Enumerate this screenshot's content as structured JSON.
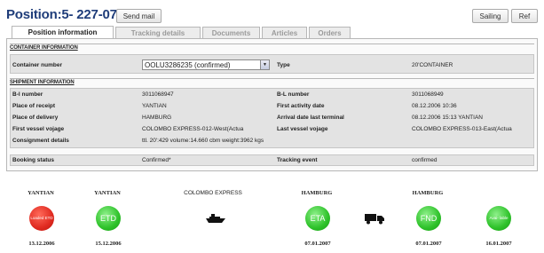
{
  "header": {
    "title": "Position:5- 227-07",
    "send_mail": "Send mail",
    "sailing": "Sailing",
    "ref": "Ref"
  },
  "tabs": [
    {
      "label": "Position information",
      "active": true
    },
    {
      "label": "Tracking details",
      "active": false
    },
    {
      "label": "Documents",
      "active": false
    },
    {
      "label": "Articles",
      "active": false
    },
    {
      "label": "Orders",
      "active": false
    }
  ],
  "container": {
    "heading": "CONTAINER INFORMATION",
    "number_label": "Container number",
    "number_value": "OOLU3286235 (confirmed)",
    "type_label": "Type",
    "type_value": "20'CONTAINER"
  },
  "shipment": {
    "heading": "SHIPMENT INFORMATION",
    "bl_number_label": "B-l number",
    "bl_number_value": "3011068947",
    "bl_number2_label": "B-L number",
    "bl_number2_value": "3011068949",
    "place_receipt_label": "Place of receipt",
    "place_receipt_value": "YANTIAN",
    "first_activity_label": "First activity date",
    "first_activity_value": "08.12.2006 10:36",
    "place_delivery_label": "Place of delivery",
    "place_delivery_value": "HAMBURG",
    "arrival_label": "Arrival date last terminal",
    "arrival_value": "08.12.2006 15:13 YANTIAN",
    "first_vessel_label": "First vessel vojage",
    "first_vessel_value": "COLOMBO EXPRESS-012-West(Actua",
    "last_vessel_label": "Last vessel vojage",
    "last_vessel_value": "COLOMBO EXPRESS-013-East(Actua",
    "consignment_label": "Consignment details",
    "consignment_value": "ttl. 20':429 volume:14.660 cbm weight:3962 kgs"
  },
  "status": {
    "booking_label": "Booking status",
    "booking_value": "Confirmed*",
    "tracking_label": "Tracking event",
    "tracking_value": "confirmed"
  },
  "timeline": {
    "loc1": "YANTIAN",
    "loc2": "YANTIAN",
    "vessel": "COLOMBO EXPRESS",
    "loc3": "HAMBURG",
    "loc4": "HAMBURG",
    "c1": "Loaded ETD",
    "c2": "ETD",
    "c3": "ETA",
    "c4": "FND",
    "c5": "Avai- lable",
    "d1": "13.12.2006",
    "d2": "15.12.2006",
    "d3": "07.01.2007",
    "d4": "07.01.2007",
    "d5": "16.01.2007",
    "red_color": "#e02a20",
    "green_color": "#2ec22a",
    "ship_icon": "ship-icon",
    "truck_icon": "truck-icon"
  }
}
